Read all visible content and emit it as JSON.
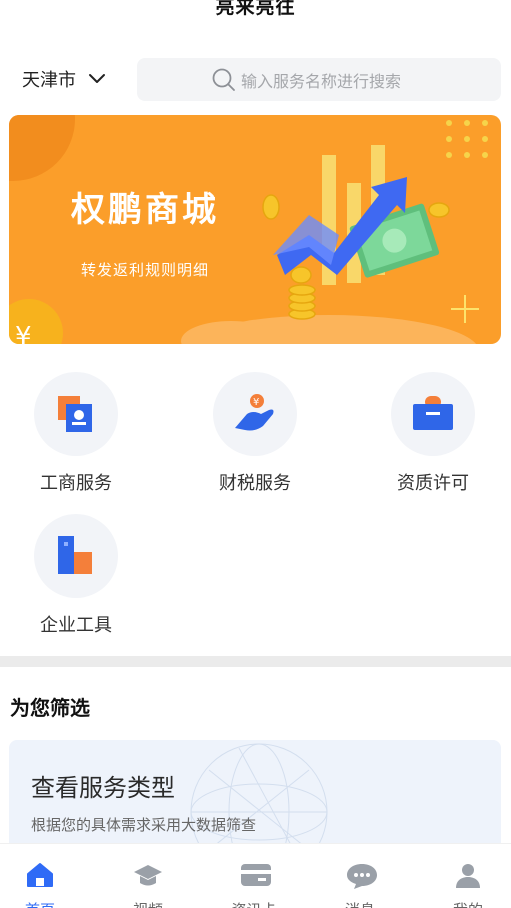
{
  "header": {
    "title": "亮来亮往"
  },
  "location": {
    "city": "天津市"
  },
  "search": {
    "placeholder": "输入服务名称进行搜索"
  },
  "banner": {
    "title": "权鹏商城",
    "subtitle": "转发返利规则明细"
  },
  "services": [
    {
      "label": "工商服务",
      "icon": "business-registration-icon"
    },
    {
      "label": "财税服务",
      "icon": "finance-tax-icon"
    },
    {
      "label": "资质许可",
      "icon": "license-briefcase-icon"
    },
    {
      "label": "企业工具",
      "icon": "enterprise-tools-icon"
    }
  ],
  "section": {
    "title": "为您筛选"
  },
  "card": {
    "title": "查看服务类型",
    "subtitle": "根据您的具体需求采用大数据筛查"
  },
  "tabs": [
    {
      "label": "首页",
      "icon": "home-icon",
      "active": true
    },
    {
      "label": "视频",
      "icon": "graduation-cap-icon",
      "active": false
    },
    {
      "label": "资讯卡",
      "icon": "card-icon",
      "active": false
    },
    {
      "label": "消息",
      "icon": "chat-icon",
      "active": false
    },
    {
      "label": "我的",
      "icon": "user-icon",
      "active": false
    }
  ],
  "colors": {
    "accent": "#2f6bf6",
    "banner": "#fb9e2a",
    "card_bg": "#eef3fb"
  }
}
